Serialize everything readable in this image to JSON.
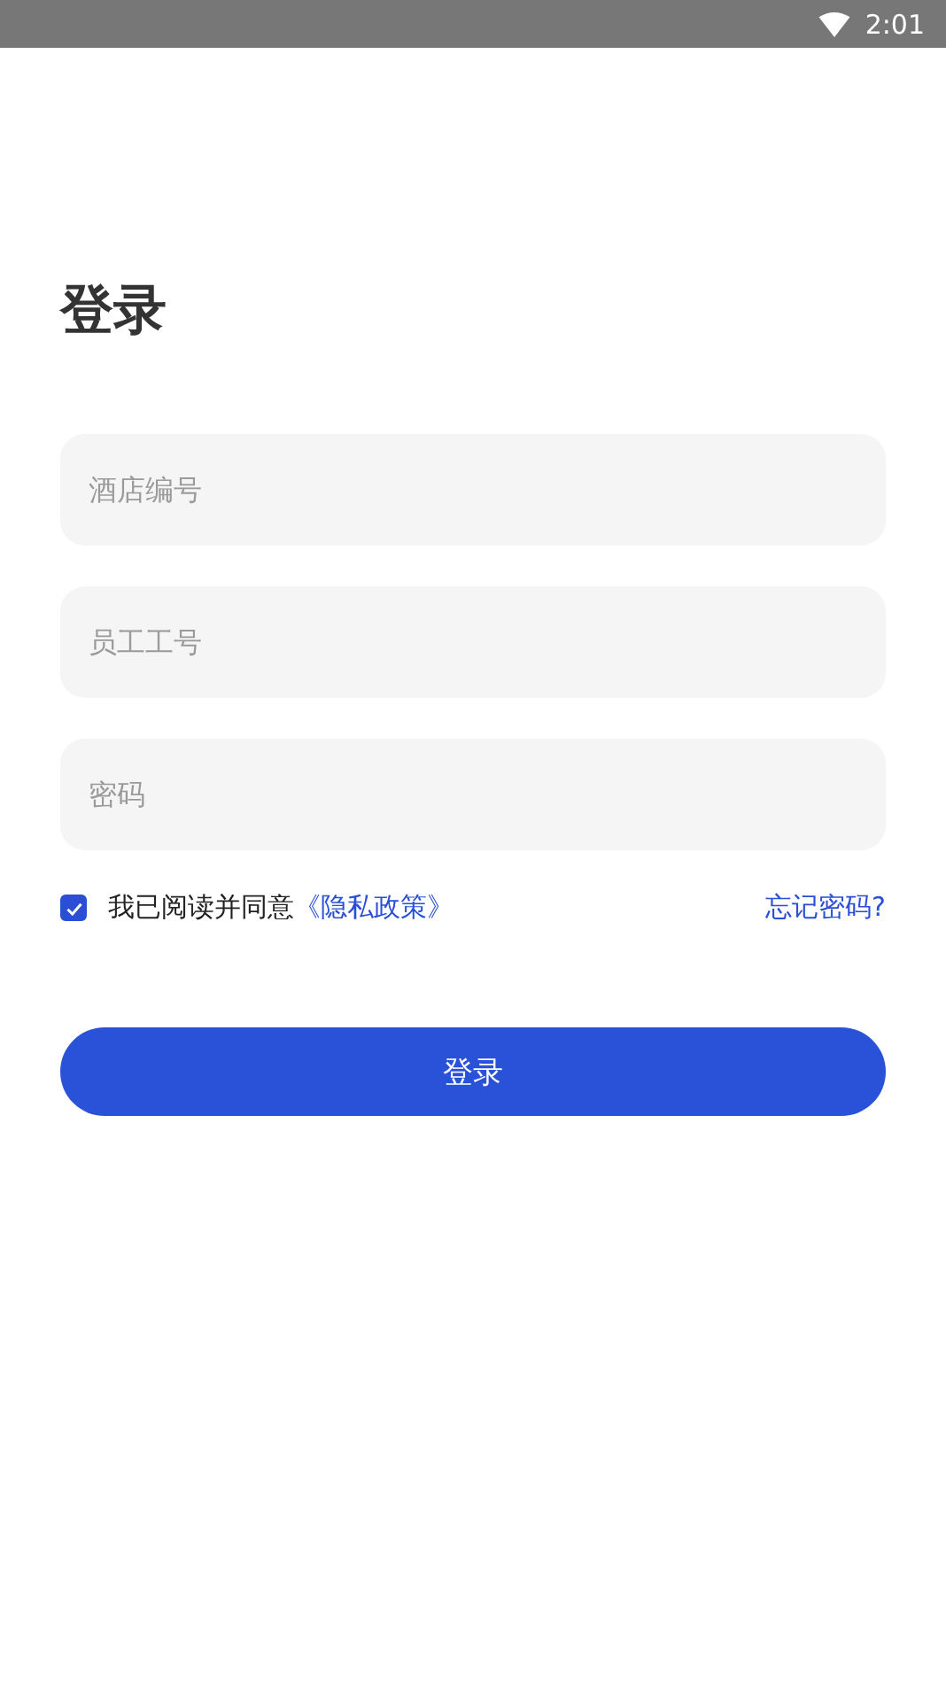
{
  "status_bar": {
    "time": "2:01"
  },
  "title": "登录",
  "fields": [
    {
      "placeholder": "酒店编号"
    },
    {
      "placeholder": "员工工号"
    },
    {
      "placeholder": "密码"
    }
  ],
  "agreement": {
    "checked": true,
    "text": "我已阅读并同意",
    "link": "《隐私政策》"
  },
  "forgot_link": "忘记密码?",
  "login_button": "登录"
}
